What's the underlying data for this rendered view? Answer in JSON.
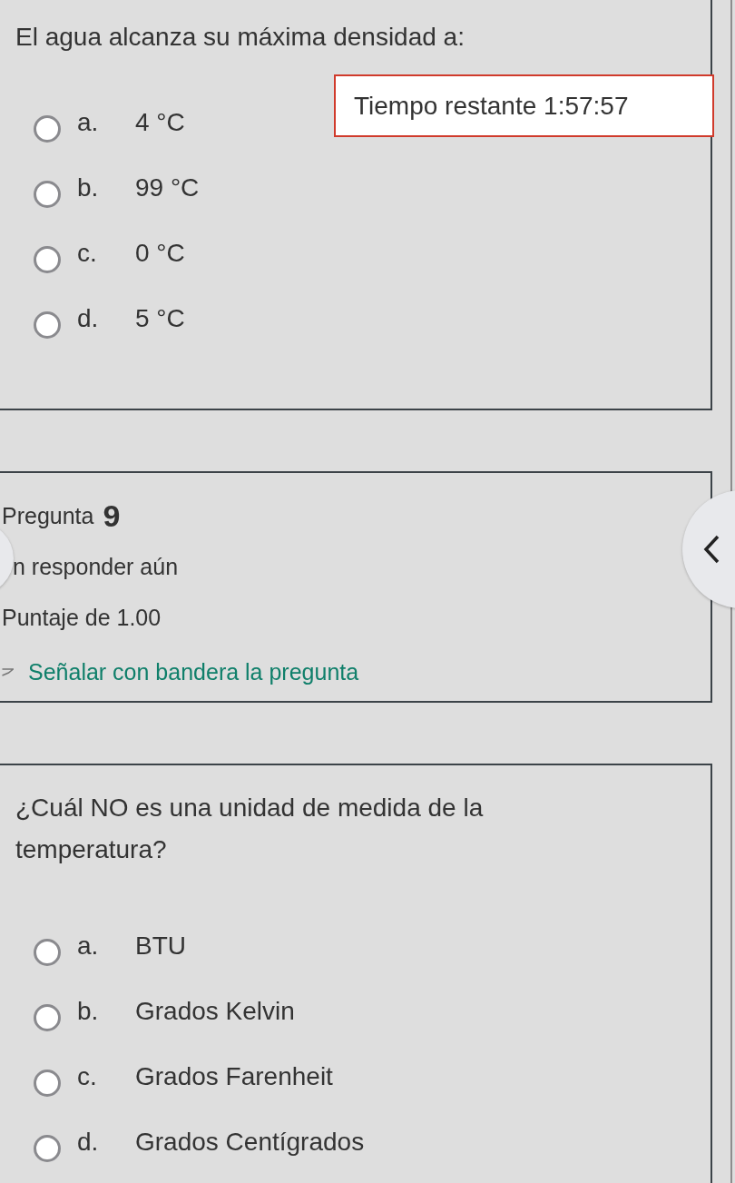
{
  "question_1": {
    "text": "El agua alcanza su máxima densidad a:",
    "options": [
      {
        "letter": "a.",
        "text": "4 °C",
        "selected": false
      },
      {
        "letter": "b.",
        "text": "99 °C",
        "selected": false
      },
      {
        "letter": "c.",
        "text": "0 °C",
        "selected": false
      },
      {
        "letter": "d.",
        "text": "5 °C",
        "selected": false
      }
    ]
  },
  "timer": {
    "text": "Tiempo restante 1:57:57"
  },
  "question_info": {
    "title": "Pregunta",
    "number": "9",
    "status": "n responder aún",
    "score": "Puntaje de 1.00",
    "flag_link": "Señalar con bandera la pregunta"
  },
  "question_2": {
    "text": "¿Cuál NO es una unidad de medida de la temperatura?",
    "options": [
      {
        "letter": "a.",
        "text": "BTU",
        "selected": false
      },
      {
        "letter": "b.",
        "text": "Grados Kelvin",
        "selected": false
      },
      {
        "letter": "c.",
        "text": "Grados Farenheit",
        "selected": false
      },
      {
        "letter": "d.",
        "text": "Grados Centígrados",
        "selected": false
      }
    ]
  }
}
